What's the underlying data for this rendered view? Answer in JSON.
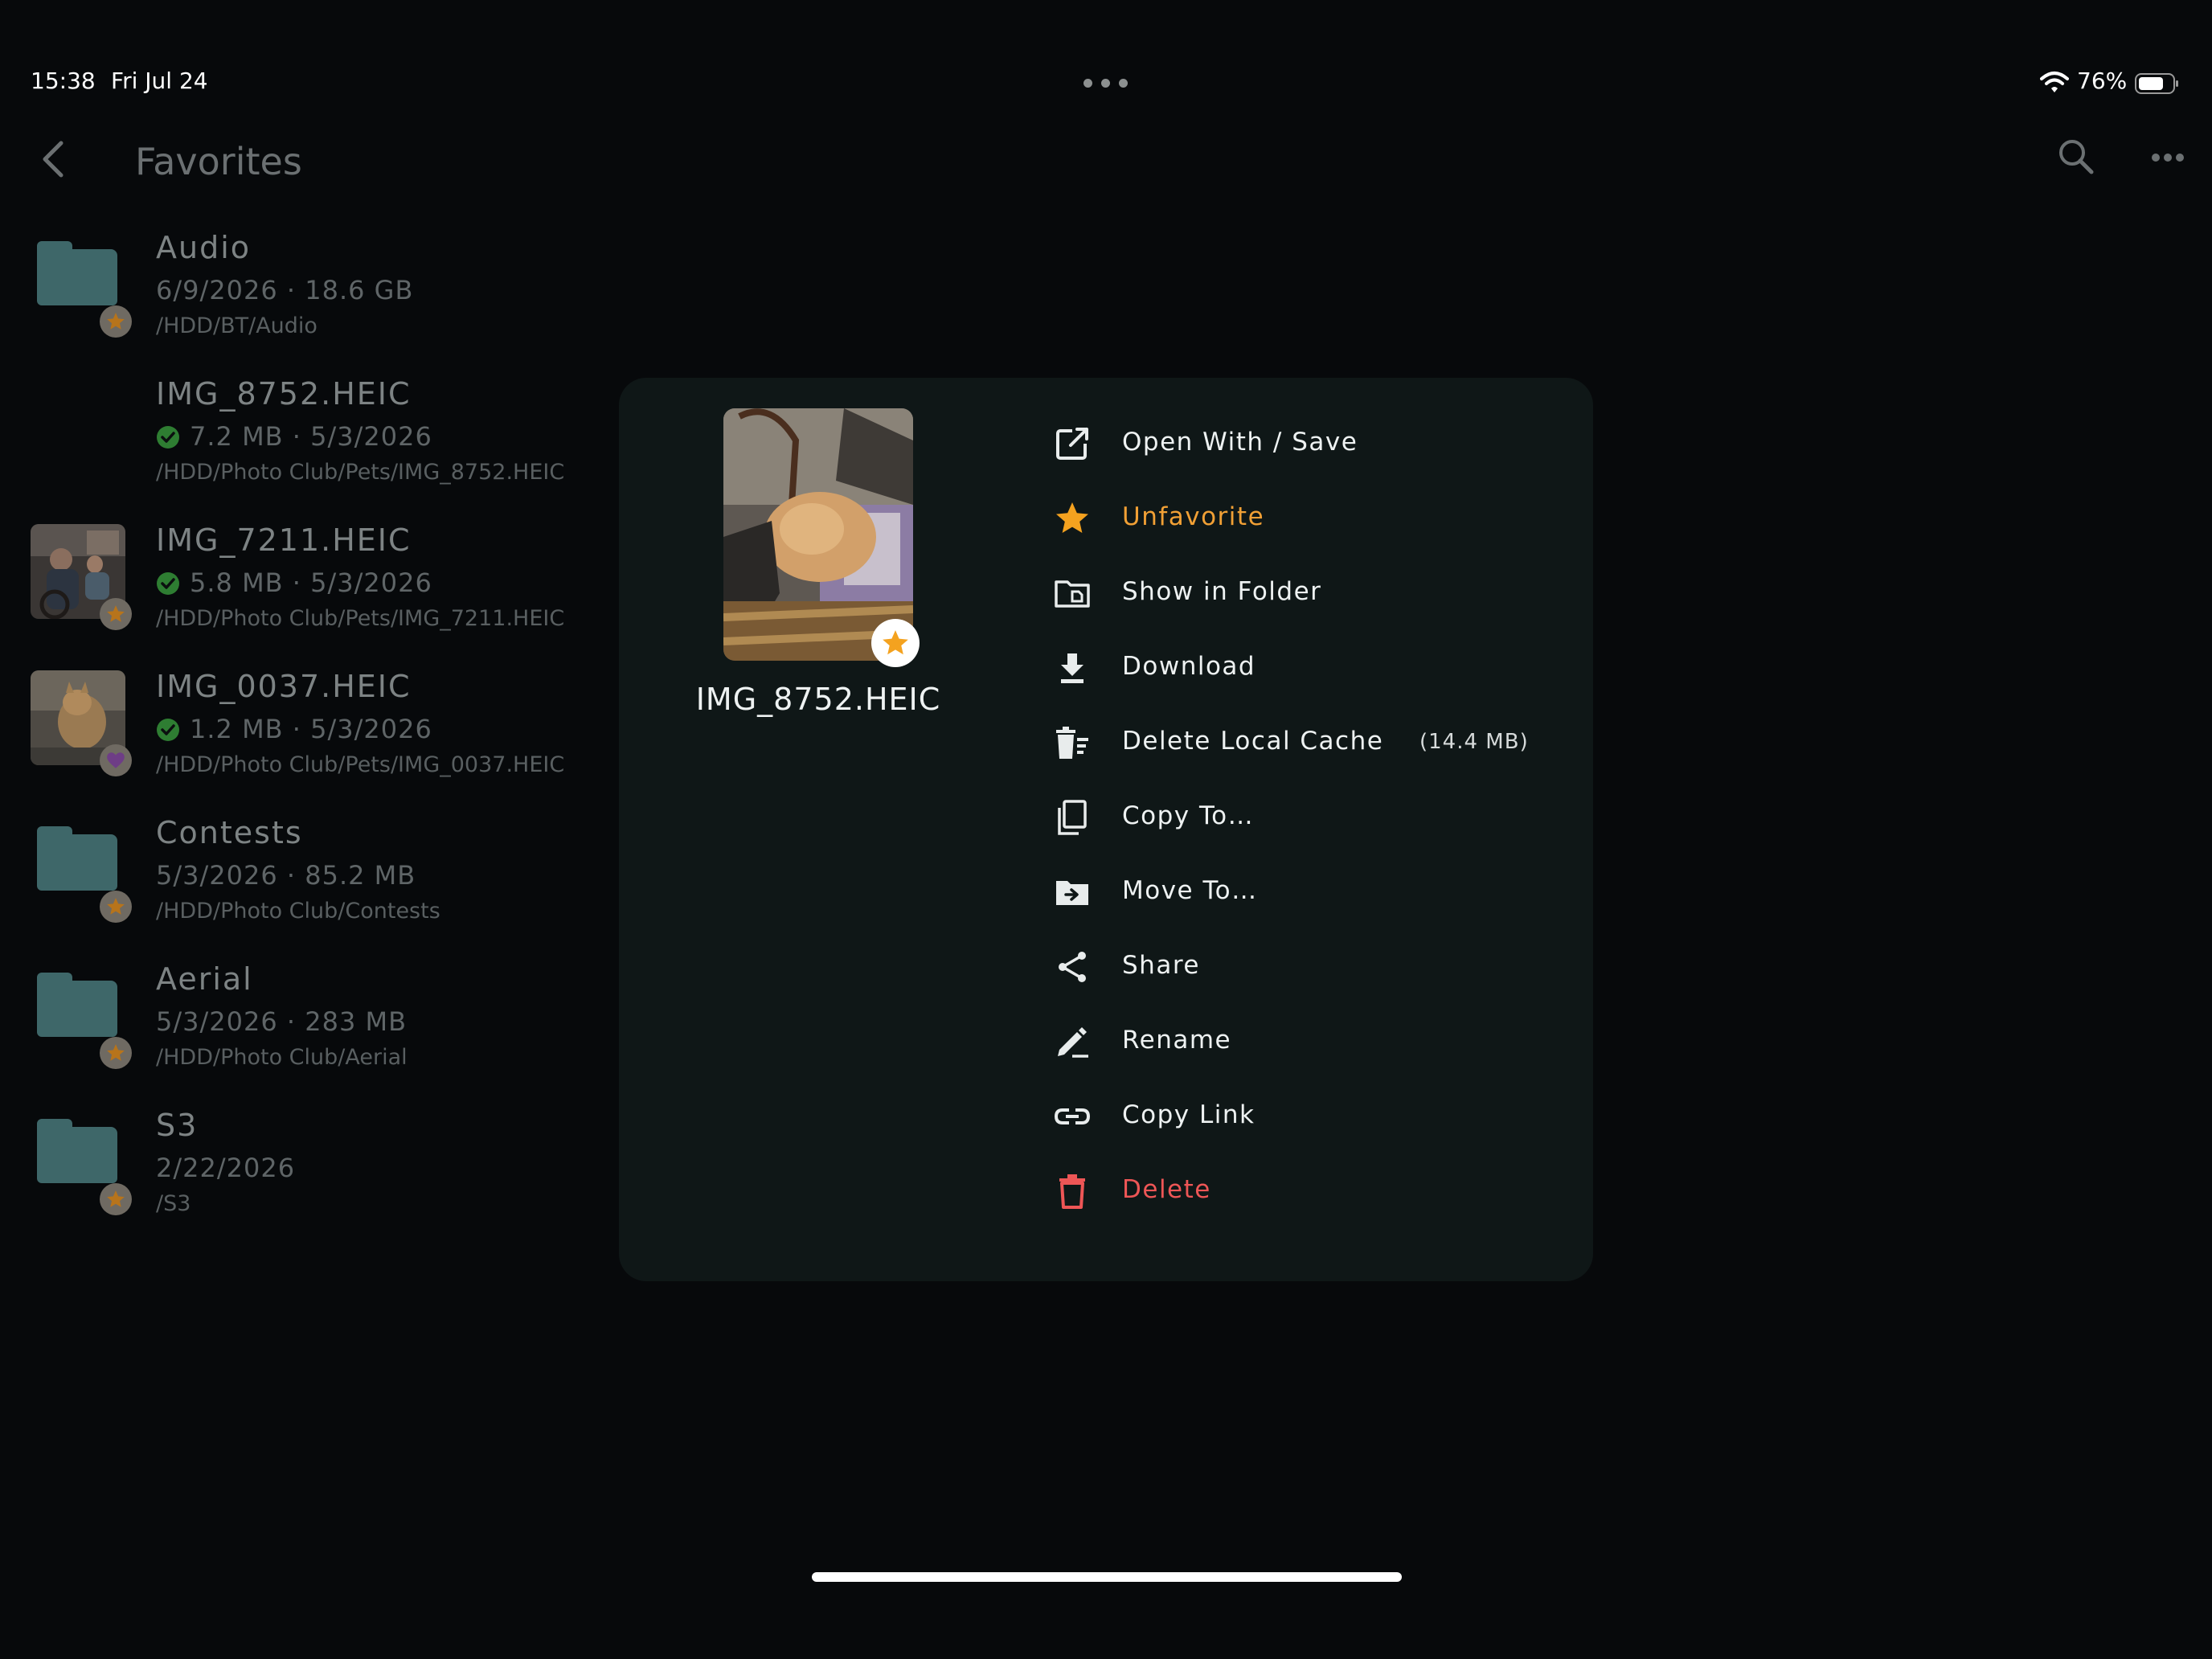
{
  "status_bar": {
    "time": "15:38",
    "date": "Fri Jul 24",
    "battery": "76%"
  },
  "header": {
    "title": "Favorites"
  },
  "files": [
    {
      "name": "Audio",
      "meta": "6/9/2026 · 18.6 GB",
      "path": "/HDD/BT/Audio",
      "kind": "folder",
      "badge": "star"
    },
    {
      "name": "IMG_8752.HEIC",
      "meta": "7.2 MB · 5/3/2026",
      "path": "/HDD/Photo Club/Pets/IMG_8752.HEIC",
      "kind": "photo-hidden",
      "badge": "none",
      "synced": true
    },
    {
      "name": "IMG_7211.HEIC",
      "meta": "5.8 MB · 5/3/2026",
      "path": "/HDD/Photo Club/Pets/IMG_7211.HEIC",
      "kind": "photo",
      "badge": "star",
      "synced": true
    },
    {
      "name": "IMG_0037.HEIC",
      "meta": "1.2 MB · 5/3/2026",
      "path": "/HDD/Photo Club/Pets/IMG_0037.HEIC",
      "kind": "photo",
      "badge": "heart",
      "synced": true
    },
    {
      "name": "Contests",
      "meta": "5/3/2026 · 85.2 MB",
      "path": "/HDD/Photo Club/Contests",
      "kind": "folder",
      "badge": "star"
    },
    {
      "name": "Aerial",
      "meta": "5/3/2026 · 283 MB",
      "path": "/HDD/Photo Club/Aerial",
      "kind": "folder",
      "badge": "star"
    },
    {
      "name": "S3",
      "meta": "2/22/2026",
      "path": "/S3",
      "kind": "folder",
      "badge": "star"
    }
  ],
  "context_menu": {
    "file_name": "IMG_8752.HEIC",
    "items": [
      {
        "label": "Open With / Save",
        "icon": "open-external-icon",
        "style": "normal"
      },
      {
        "label": "Unfavorite",
        "icon": "star-icon",
        "style": "orange"
      },
      {
        "label": "Show in Folder",
        "icon": "folder-show-icon",
        "style": "normal"
      },
      {
        "label": "Download",
        "icon": "download-icon",
        "style": "normal"
      },
      {
        "label": "Delete Local Cache",
        "icon": "delete-cache-icon",
        "style": "normal",
        "extra": "(14.4 MB)"
      },
      {
        "label": "Copy To…",
        "icon": "copy-icon",
        "style": "normal"
      },
      {
        "label": "Move To…",
        "icon": "move-folder-icon",
        "style": "normal"
      },
      {
        "label": "Share",
        "icon": "share-icon",
        "style": "normal"
      },
      {
        "label": "Rename",
        "icon": "rename-icon",
        "style": "normal"
      },
      {
        "label": "Copy Link",
        "icon": "link-icon",
        "style": "normal"
      },
      {
        "label": "Delete",
        "icon": "trash-icon",
        "style": "red"
      }
    ]
  },
  "colors": {
    "background": "#07090b",
    "panel": "#0f1717",
    "folder": "#3e6769",
    "accent_orange": "#f1a035",
    "danger_red": "#ee5656",
    "sync_green": "#2e7d32"
  }
}
